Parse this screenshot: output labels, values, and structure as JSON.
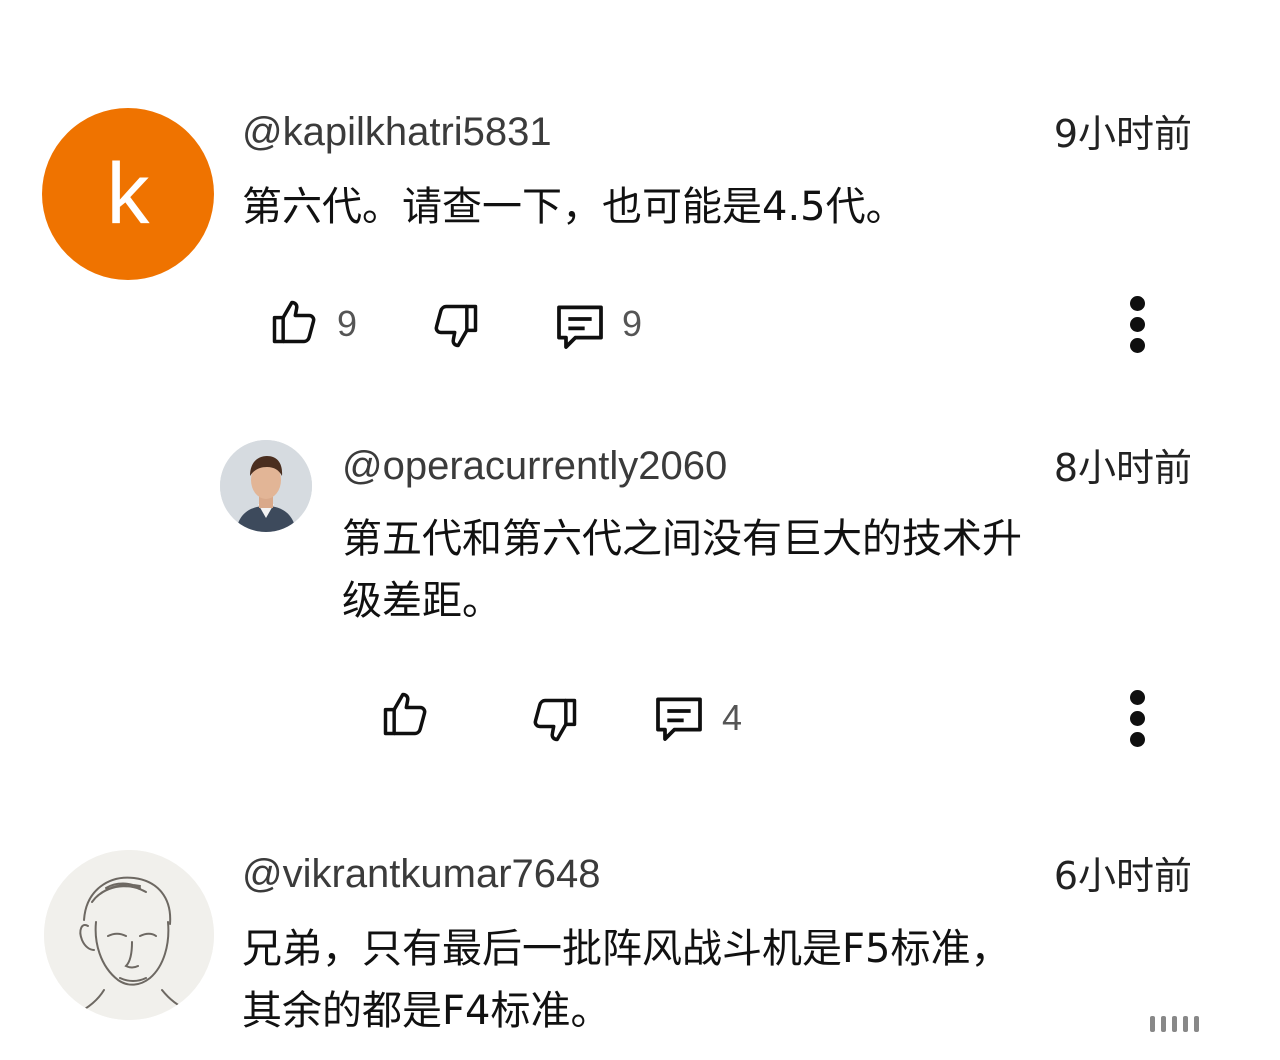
{
  "comments": [
    {
      "avatar_letter": "k",
      "avatar_color": "#ef7300",
      "handle": "@kapilkhatri5831",
      "time": "9小时前",
      "text": "第六代。请查一下，也可能是4.5代。",
      "likes": "9",
      "replies": "9"
    },
    {
      "handle": "@operacurrently2060",
      "time": "8小时前",
      "text_line1": "第五代和第六代之间没有巨大的技术升",
      "text_line2": "级差距。",
      "likes": "",
      "replies": "4"
    },
    {
      "handle": "@vikrantkumar7648",
      "time": "6小时前",
      "text_line1": "兄弟，只有最后一批阵风战斗机是F5标准，",
      "text_line2": "其余的都是F4标准。"
    }
  ],
  "icons": {
    "like": "thumbs-up-icon",
    "dislike": "thumbs-down-icon",
    "reply": "comment-icon",
    "more": "more-vertical-icon"
  }
}
